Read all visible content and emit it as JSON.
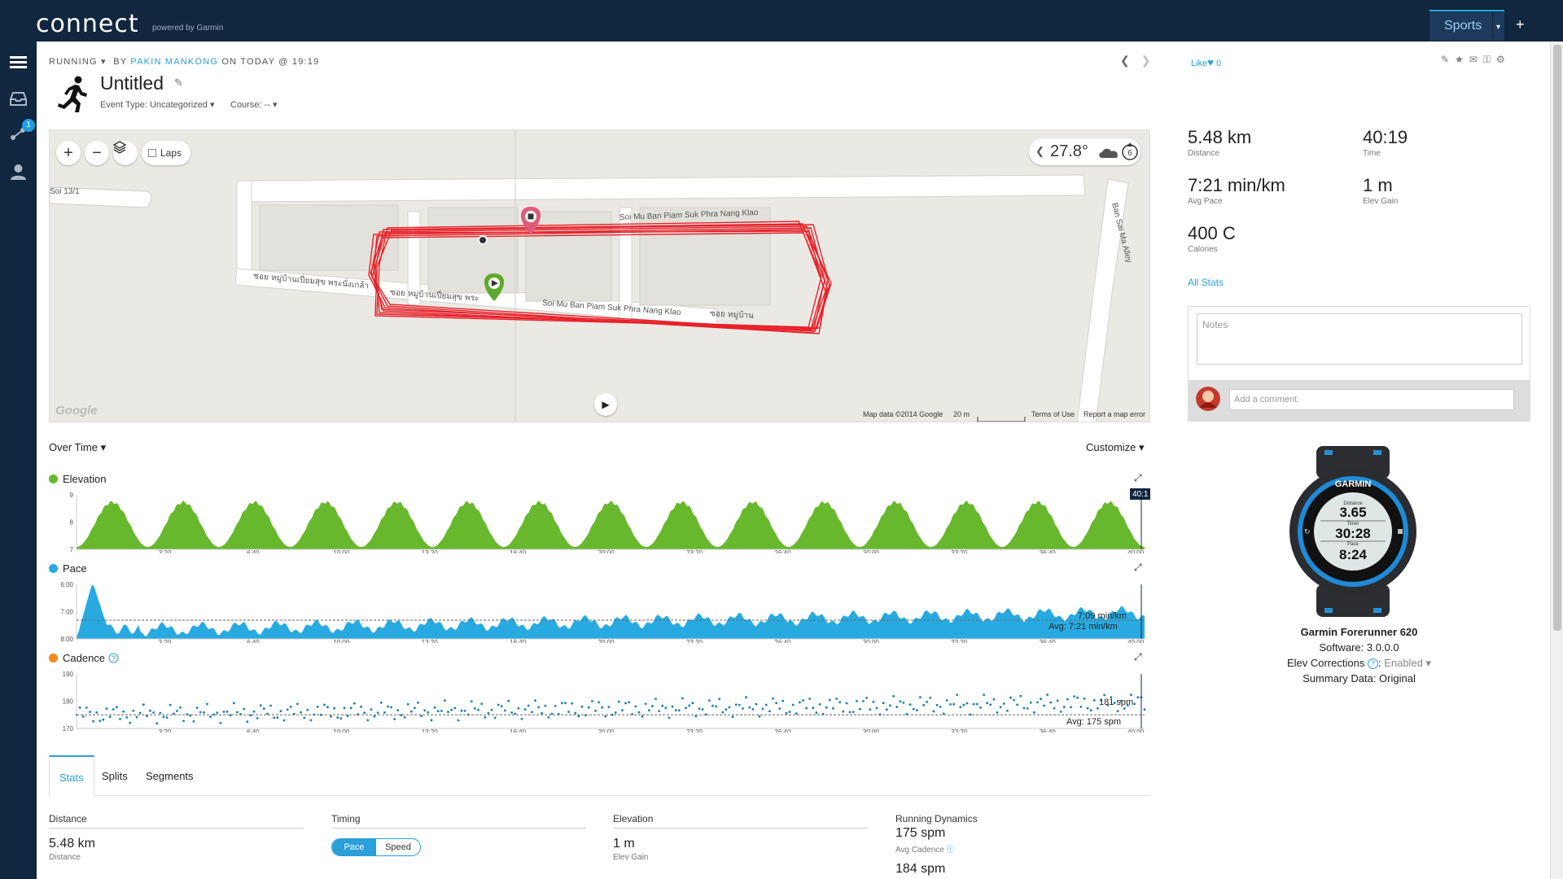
{
  "topbar": {
    "logo": "connect",
    "logo_sub": "powered by Garmin",
    "sports_label": "Sports",
    "plus": "+"
  },
  "sidebar": {
    "notification_count": "1"
  },
  "activity": {
    "breadcrumb_type": "RUNNING",
    "breadcrumb_by": "BY",
    "author": "PAKIN MANKONG",
    "breadcrumb_when": "ON TODAY @ 19:19",
    "title": "Untitled",
    "event_type": "Event Type: Uncategorized",
    "course": "Course: --"
  },
  "map": {
    "laps_label": "Laps",
    "temperature": "27.8°",
    "wind_value": "6",
    "roads": [
      "Soi 13/1",
      "Soi Mu Ban Piam Suk Phra Nang Klao",
      "Soi Mu Ban Piam Suk Phra Nang Klao",
      "Ban Sai Ma Alley",
      "ซอย หมู่บ้านเปี่ยมสุข พระนั่งเกล้า",
      "ซอย หมู่บ้านเปี่ยมสุข พระ",
      "ซอย หมู่บ้าน"
    ],
    "attribution": "Map data ©2014 Google",
    "scale": "20 m",
    "terms": "Terms of Use",
    "report": "Report a map error",
    "google": "Google"
  },
  "charts": {
    "over_time_label": "Over Time",
    "customize_label": "Customize",
    "elevation_label": "Elevation",
    "pace_label": "Pace",
    "cadence_label": "Cadence",
    "elevation_end_time": "40:1"
  },
  "chart_data": [
    {
      "type": "area",
      "title": "Elevation",
      "x_ticks": [
        "3:20",
        "6:40",
        "10:00",
        "13:20",
        "16:40",
        "20:00",
        "23:20",
        "26:40",
        "30:00",
        "33:20",
        "36:40",
        "40:00"
      ],
      "y_ticks": [
        "9",
        "8",
        "7"
      ],
      "ylim": [
        7,
        9
      ],
      "peaks_count": 15,
      "series": [
        {
          "name": "Elevation",
          "color": "#68b82d"
        }
      ]
    },
    {
      "type": "area",
      "title": "Pace",
      "x_ticks": [
        "3:20",
        "6:40",
        "10:00",
        "13:20",
        "16:40",
        "20:00",
        "23:20",
        "26:40",
        "30:00",
        "33:20",
        "36:40",
        "40:00"
      ],
      "y_ticks": [
        "6:00",
        "7:00",
        "8:00"
      ],
      "ylim": [
        "8:00",
        "6:00"
      ],
      "current_label": "7:09 min/km",
      "avg_label": "Avg: 7:21 min/km",
      "series": [
        {
          "name": "Pace",
          "color": "#28aae1"
        }
      ]
    },
    {
      "type": "scatter",
      "title": "Cadence",
      "x_ticks": [
        "3:20",
        "6:40",
        "10:00",
        "13:20",
        "16:40",
        "20:00",
        "23:20",
        "26:40",
        "30:00",
        "33:20",
        "36:40",
        "40:00"
      ],
      "y_ticks": [
        "190",
        "180",
        "170"
      ],
      "ylim": [
        170,
        190
      ],
      "current_label": "181 spm",
      "avg_label": "Avg: 175 spm",
      "avg": 175,
      "series": [
        {
          "name": "Cadence",
          "color": "#1b7bb3"
        }
      ]
    }
  ],
  "tabs": {
    "stats": "Stats",
    "splits": "Splits",
    "segments": "Segments"
  },
  "stats_table": {
    "distance_head": "Distance",
    "distance_value": "5.48 km",
    "distance_label": "Distance",
    "timing_head": "Timing",
    "pace_btn": "Pace",
    "speed_btn": "Speed",
    "elevation_head": "Elevation",
    "elev_gain_value": "1 m",
    "elev_gain_label": "Elev Gain",
    "dynamics_head": "Running Dynamics",
    "avg_cadence_value": "175 spm",
    "avg_cadence_label": "Avg Cadence",
    "max_cadence_value": "184 spm"
  },
  "right": {
    "like_label": "Like",
    "like_count": "0",
    "distance": "5.48 km",
    "distance_label": "Distance",
    "time": "40:19",
    "time_label": "Time",
    "avg_pace": "7:21 min/km",
    "avg_pace_label": "Avg Pace",
    "elev_gain": "1 m",
    "elev_gain_label": "Elev Gain",
    "calories": "400 C",
    "calories_label": "Calories",
    "all_stats": "All Stats",
    "notes_placeholder": "Notes",
    "comment_placeholder": "Add a comment."
  },
  "device": {
    "brand": "GARMIN",
    "screen_distance_label": "Distance",
    "screen_distance": "3.65",
    "screen_timer_label": "Timer",
    "screen_timer": "30:28",
    "screen_pace_label": "Pace",
    "screen_pace": "8:24",
    "name": "Garmin Forerunner 620",
    "software": "Software: 3.0.0.0",
    "elev_corrections": "Elev Corrections",
    "elev_corrections_value": "Enabled",
    "summary_data": "Summary Data: Original"
  },
  "colors": {
    "brand_dark": "#11263f",
    "accent": "#2a9fd8",
    "elevation": "#68b82d",
    "pace": "#28aae1",
    "cadence": "#1b7bb3",
    "track": "#e8222a"
  }
}
